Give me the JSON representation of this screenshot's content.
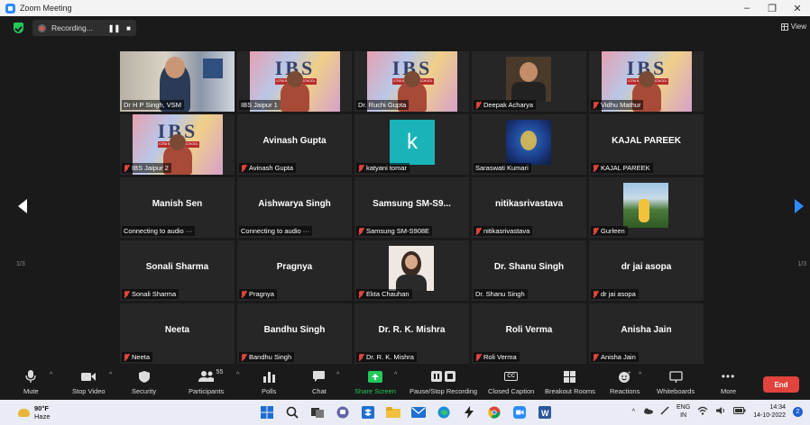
{
  "window": {
    "title": "Zoom Meeting"
  },
  "topbar": {
    "recording_label": "Recording...",
    "pause_glyph": "❚❚",
    "stop_glyph": "■",
    "view_label": "View"
  },
  "gallery": {
    "page_left": "1/3",
    "page_right": "1/3",
    "tiles": [
      {
        "name": "Dr H P Singh, VSM",
        "display": "",
        "muted": false,
        "video": "room",
        "speaking": true
      },
      {
        "name": "IBS Jaipur 1",
        "display": "",
        "muted": false,
        "video": "ibs"
      },
      {
        "name": "Dr. Ruchi Gupta",
        "display": "",
        "muted": false,
        "video": "ibs"
      },
      {
        "name": "Deepak Acharya",
        "display": "",
        "muted": true,
        "video": "photo-dark"
      },
      {
        "name": "Vidhu Mathur",
        "display": "",
        "muted": true,
        "video": "ibs"
      },
      {
        "name": "IBS Jaipur 2",
        "display": "",
        "muted": true,
        "video": "ibs"
      },
      {
        "name": "Avinash Gupta",
        "display": "Avinash Gupta",
        "muted": true,
        "video": "none"
      },
      {
        "name": "katyani tomar",
        "display": "",
        "muted": true,
        "video": "k-avatar",
        "avatar_letter": "k"
      },
      {
        "name": "Saraswati Kumari",
        "display": "",
        "muted": false,
        "video": "ganesha"
      },
      {
        "name": "KAJAL PAREEK",
        "display": "KAJAL PAREEK",
        "muted": true,
        "video": "none"
      },
      {
        "name": "Connecting to audio ···",
        "display": "Manish Sen",
        "muted": false,
        "video": "none"
      },
      {
        "name": "Connecting to audio ···",
        "display": "Aishwarya Singh",
        "muted": false,
        "video": "none"
      },
      {
        "name": "Samsung SM-S908E",
        "display": "Samsung  SM-S9...",
        "muted": true,
        "video": "none"
      },
      {
        "name": "nitikasrivastava",
        "display": "nitikasrivastava",
        "muted": true,
        "video": "none"
      },
      {
        "name": "Gurleen",
        "display": "",
        "muted": true,
        "video": "landscape"
      },
      {
        "name": "Sonali Sharma",
        "display": "Sonali Sharma",
        "muted": true,
        "video": "none"
      },
      {
        "name": "Pragnya",
        "display": "Pragnya",
        "muted": true,
        "video": "none"
      },
      {
        "name": "Ekta Chauhan",
        "display": "",
        "muted": true,
        "video": "portrait"
      },
      {
        "name": "Dr. Shanu Singh",
        "display": "Dr. Shanu Singh",
        "muted": false,
        "video": "none"
      },
      {
        "name": "dr jai asopa",
        "display": "dr jai asopa",
        "muted": true,
        "video": "none"
      },
      {
        "name": "Neeta",
        "display": "Neeta",
        "muted": true,
        "video": "none"
      },
      {
        "name": "Bandhu Singh",
        "display": "Bandhu Singh",
        "muted": true,
        "video": "none"
      },
      {
        "name": "Dr. R. K. Mishra",
        "display": "Dr. R. K. Mishra",
        "muted": true,
        "video": "none"
      },
      {
        "name": "Roli Verma",
        "display": "Roli Verma",
        "muted": true,
        "video": "none"
      },
      {
        "name": "Anisha Jain",
        "display": "Anisha Jain",
        "muted": true,
        "video": "none"
      }
    ]
  },
  "toolbar": {
    "mute": "Mute",
    "stop_video": "Stop Video",
    "security": "Security",
    "participants": "Participants",
    "participants_count": "55",
    "polls": "Polls",
    "chat": "Chat",
    "share_screen": "Share Screen",
    "pause_recording": "Pause/Stop Recording",
    "closed_caption": "Closed Caption",
    "cc_glyph": "CC",
    "breakout_rooms": "Breakout Rooms",
    "reactions": "Reactions",
    "whiteboards": "Whiteboards",
    "more": "More",
    "end": "End",
    "accent": "#23c85a",
    "end_color": "#e0443c"
  },
  "taskbar": {
    "temp": "90°F",
    "weather": "Haze",
    "lang1": "ENG",
    "lang2": "IN",
    "time": "14:34",
    "date": "14-10-2022",
    "notifications": "2"
  }
}
